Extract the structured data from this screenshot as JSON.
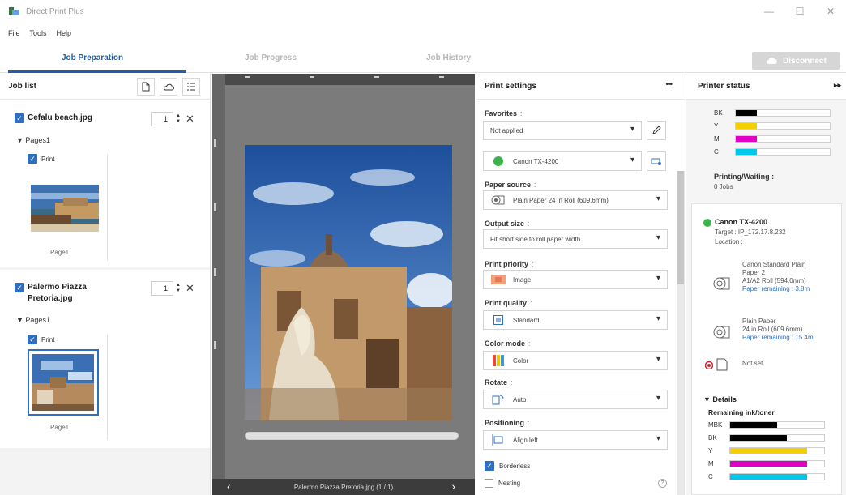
{
  "window": {
    "title": "Direct Print Plus",
    "controls": [
      "—",
      "☐",
      "✕"
    ]
  },
  "menu": [
    "File",
    "Tools",
    "Help"
  ],
  "tabs": [
    {
      "label": "Job Preparation"
    },
    {
      "label": "Job Progress"
    },
    {
      "label": "Job History"
    }
  ],
  "disconnect_label": "Disconnect",
  "job_list": {
    "title": "Job list",
    "jobs": [
      {
        "name": "Cefalu beach.jpg",
        "qty": "1",
        "pages_label": "Pages1",
        "print_label": "Print",
        "page_caption": "Page1"
      },
      {
        "name_line1": "Palermo Piazza",
        "name_line2": "Pretoria.jpg",
        "qty": "1",
        "pages_label": "Pages1",
        "print_label": "Print",
        "page_caption": "Page1"
      }
    ]
  },
  "preview": {
    "caption": "Palermo Piazza Pretoria.jpg (1 / 1)"
  },
  "print_settings": {
    "title": "Print settings",
    "more": "•••",
    "favorites_label": "Favorites",
    "favorites_value": "Not applied",
    "printer_value": "Canon TX-4200",
    "paper_source_label": "Paper source",
    "paper_source_value": "Plain Paper 24 in Roll (609.6mm)",
    "output_size_label": "Output size",
    "output_size_value": "Fit short side to roll paper width",
    "print_priority_label": "Print priority",
    "print_priority_value": "Image",
    "print_quality_label": "Print quality",
    "print_quality_value": "Standard",
    "color_mode_label": "Color mode",
    "color_mode_value": "Color",
    "rotate_label": "Rotate",
    "rotate_value": "Auto",
    "positioning_label": "Positioning",
    "positioning_value": "Align left",
    "borderless_label": "Borderless",
    "nesting_label": "Nesting",
    "info_sep": ":"
  },
  "printer_status": {
    "title": "Printer status",
    "top_inks": [
      {
        "label": "BK",
        "level": 0.22,
        "color": "#000000"
      },
      {
        "label": "Y",
        "level": 0.22,
        "color": "#f5d000"
      },
      {
        "label": "M",
        "level": 0.22,
        "color": "#e000c8"
      },
      {
        "label": "C",
        "level": 0.22,
        "color": "#00c8ec"
      }
    ],
    "printing_waiting_label": "Printing/Waiting :",
    "printing_waiting_value": "0 Jobs",
    "printer_name": "Canon TX-4200",
    "target": "Target : IP_172.17.8.232",
    "location": "Location :",
    "roll1_line1": "Canon Standard Plain",
    "roll1_line2": "Paper 2",
    "roll1_line3": "A1/A2 Roll (594.0mm)",
    "roll1_remaining": "Paper remaining : 3.8m",
    "roll2_line1": "Plain Paper",
    "roll2_line2": "24 in Roll (609.6mm)",
    "roll2_remaining": "Paper remaining : 15.4m",
    "sheet_value": "Not set",
    "details_label": "▼ Details",
    "remaining_label": "Remaining ink/toner",
    "bottom_inks": [
      {
        "label": "MBK",
        "level": 0.5,
        "color": "#000000"
      },
      {
        "label": "BK",
        "level": 0.6,
        "color": "#000000"
      },
      {
        "label": "Y",
        "level": 0.82,
        "color": "#f5d000"
      },
      {
        "label": "M",
        "level": 0.82,
        "color": "#e000c8"
      },
      {
        "label": "C",
        "level": 0.82,
        "color": "#00c8ec"
      }
    ]
  }
}
